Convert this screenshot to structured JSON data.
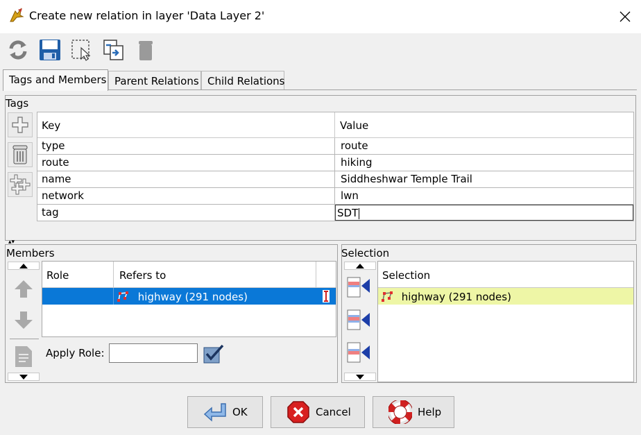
{
  "window": {
    "title": "Create new relation in layer 'Data Layer 2'",
    "app_icon": "josm-icon",
    "close_glyph": "✕"
  },
  "toolbar": {
    "buttons": [
      "refresh-icon",
      "save-icon",
      "select-area-icon",
      "duplicate-relation-icon",
      "delete-relation-icon"
    ]
  },
  "tabs": [
    {
      "label": "Tags and Members",
      "active": true
    },
    {
      "label": "Parent Relations",
      "active": false
    },
    {
      "label": "Child Relations",
      "active": false
    }
  ],
  "tags": {
    "section_label": "Tags",
    "columns": {
      "key": "Key",
      "value": "Value"
    },
    "rows": [
      {
        "key": "type",
        "value": "route"
      },
      {
        "key": "route",
        "value": "hiking"
      },
      {
        "key": "name",
        "value": "Siddheshwar Temple Trail"
      },
      {
        "key": "network",
        "value": "lwn"
      },
      {
        "key": "tag",
        "value": "SDT"
      }
    ]
  },
  "members": {
    "section_label": "Members",
    "columns": {
      "role": "Role",
      "refers_to": "Refers to"
    },
    "rows": [
      {
        "role": "",
        "refers_to": "highway (291 nodes)"
      }
    ],
    "apply_role_label": "Apply Role:",
    "apply_role_value": ""
  },
  "selection": {
    "section_label": "Selection",
    "column": "Selection",
    "rows": [
      "highway (291 nodes)"
    ]
  },
  "buttons": {
    "ok": "OK",
    "cancel": "Cancel",
    "help": "Help"
  },
  "colors": {
    "selected_row": "#0a78d7",
    "selection_highlight": "#eef6a6",
    "window_bg": "#f0f0f0"
  }
}
